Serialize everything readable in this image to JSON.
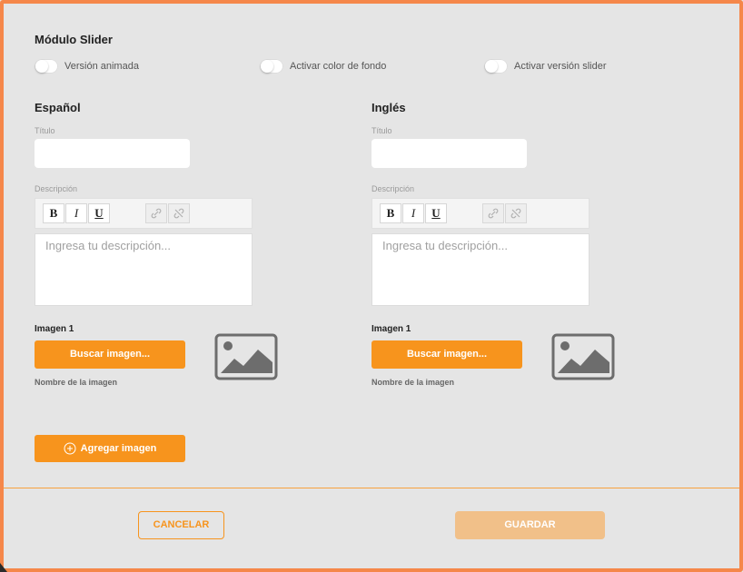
{
  "module_title": "Módulo Slider",
  "toggles": [
    {
      "label": "Versión animada",
      "on": false
    },
    {
      "label": "Activar color de fondo",
      "on": false
    },
    {
      "label": "Activar versión slider",
      "on": false
    }
  ],
  "spanish": {
    "heading": "Español",
    "title_label": "Título",
    "title_value": "",
    "description_label": "Descripción",
    "description_placeholder": "Ingresa tu descripción...",
    "image_label": "Imagen 1",
    "search_button": "Buscar imagen...",
    "image_name": "Nombre de la imagen"
  },
  "english": {
    "heading": "Inglés",
    "title_label": "Título",
    "title_value": "",
    "description_label": "Descripción",
    "description_placeholder": "Ingresa tu descripción...",
    "image_label": "Imagen 1",
    "search_button": "Buscar imagen...",
    "image_name": "Nombre de la imagen"
  },
  "toolbar": {
    "bold": "B",
    "italic": "I",
    "underline": "U"
  },
  "add_image_button": "Agregar imagen",
  "footer": {
    "cancel": "CANCELAR",
    "save": "GUARDAR"
  },
  "colors": {
    "accent": "#f7941d",
    "frame": "#f5874a",
    "save_disabled": "#f1c089",
    "background": "#e5e5e5"
  }
}
